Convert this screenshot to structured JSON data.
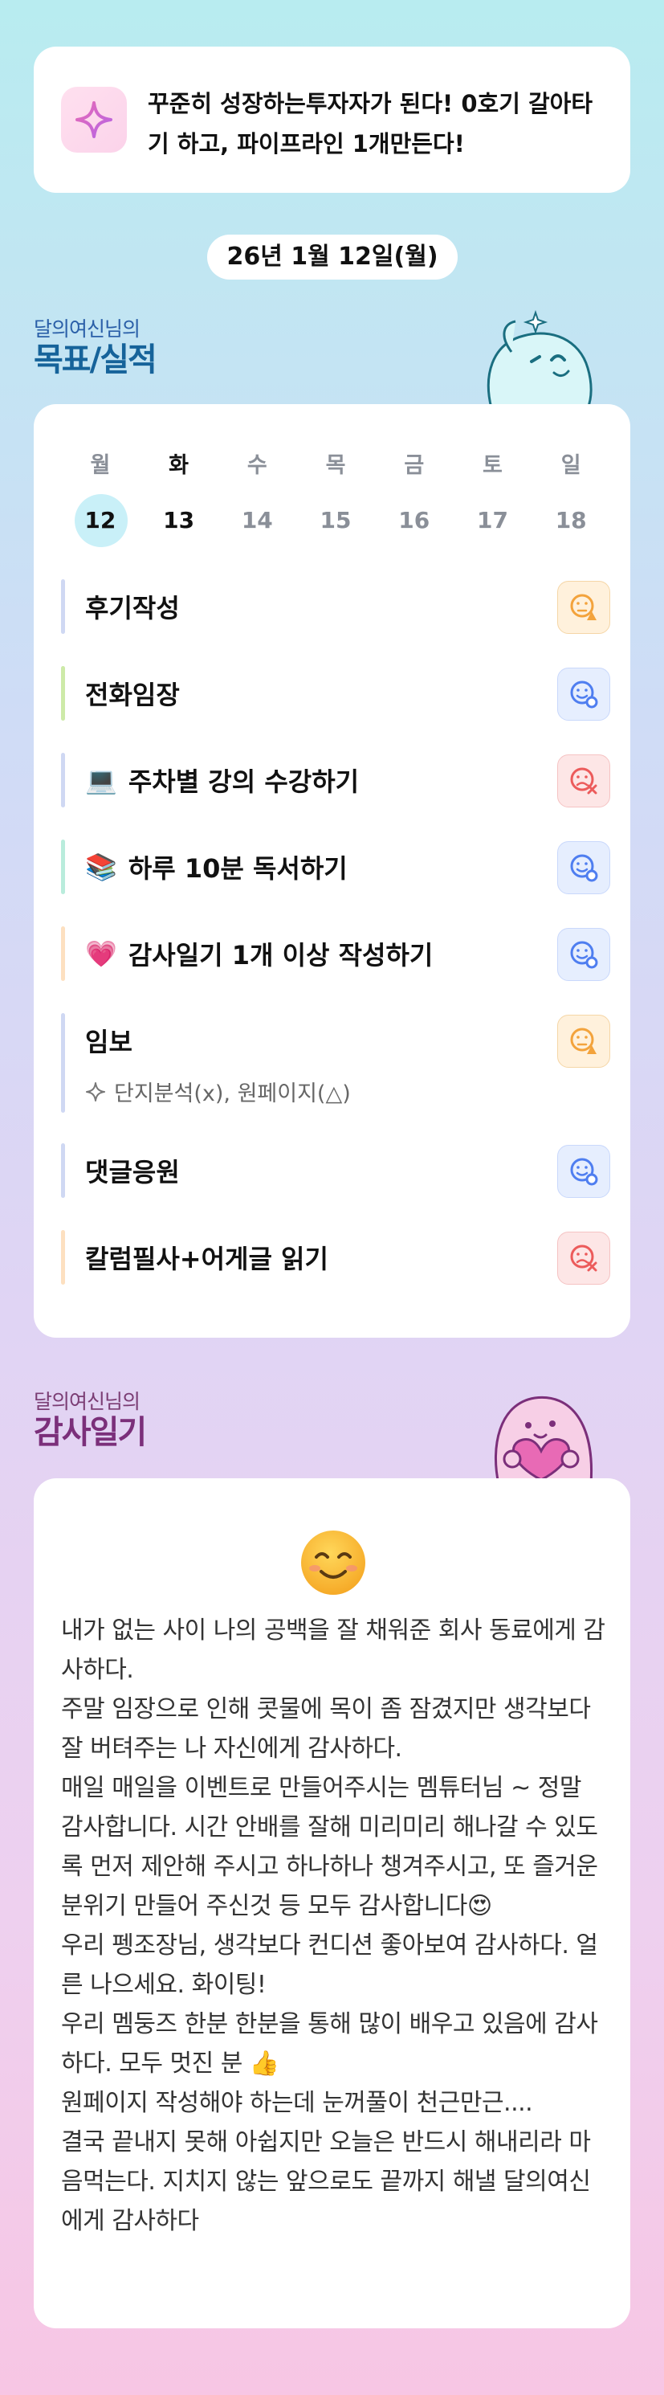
{
  "goal": {
    "icon": "sparkle-icon",
    "text": "꾸준히 성장하는투자자가 된다! 0호기 갈아타기 하고, 파이프라인 1개만든다!"
  },
  "date_label": "26년 1월 12일(월)",
  "goals_section": {
    "subtitle": "달의여신님의",
    "title": "목표/실적"
  },
  "week": {
    "days": [
      "월",
      "화",
      "수",
      "목",
      "금",
      "토",
      "일"
    ],
    "dates": [
      "12",
      "13",
      "14",
      "15",
      "16",
      "17",
      "18"
    ],
    "selected_index": 0,
    "today_index": 1
  },
  "tasks": [
    {
      "name": "후기작성",
      "emoji": "",
      "bar_color": "#cfd8f3",
      "status": "warning",
      "status_icon": "face-warning-icon"
    },
    {
      "name": "전화임장",
      "emoji": "",
      "bar_color": "#cdeaa8",
      "status": "done",
      "status_icon": "face-check-icon"
    },
    {
      "name": "주차별 강의 수강하기",
      "emoji": "💻",
      "bar_color": "#cfd8f3",
      "status": "failed",
      "status_icon": "face-x-icon"
    },
    {
      "name": "하루 10분 독서하기",
      "emoji": "📚",
      "bar_color": "#b9ecdc",
      "status": "done",
      "status_icon": "face-check-icon"
    },
    {
      "name": "감사일기 1개 이상 작성하기",
      "emoji": "💗",
      "bar_color": "#fde0c0",
      "status": "done",
      "status_icon": "face-check-icon"
    },
    {
      "name": "임보",
      "emoji": "",
      "bar_color": "#cfd8f3",
      "status": "warning",
      "status_icon": "face-warning-icon",
      "note": "단지분석(x), 원페이지(△)"
    },
    {
      "name": "댓글응원",
      "emoji": "",
      "bar_color": "#cfd8f3",
      "status": "done",
      "status_icon": "face-check-icon"
    },
    {
      "name": "칼럼필사+어게글 읽기",
      "emoji": "",
      "bar_color": "#fde0c0",
      "status": "failed",
      "status_icon": "face-x-icon"
    }
  ],
  "gratitude_section": {
    "subtitle": "달의여신님의",
    "title": "감사일기"
  },
  "gratitude": {
    "mood_icon": "smiling-face-icon",
    "lines": [
      "내가 없는 사이 나의 공백을 잘 채워준 회사 동료에게 감사하다.",
      "주말 임장으로 인해 콧물에 목이 좀 잠겼지만 생각보다 잘 버텨주는 나 자신에게 감사하다.",
      "매일 매일을 이벤트로 만들어주시는 멤튜터님 ~ 정말 감사합니다. 시간 안배를 잘해 미리미리 해나갈 수 있도록 먼저 제안해 주시고 하나하나 챙겨주시고, 또 즐거운 분위기 만들어 주신것 등 모두 감사합니다😍",
      "우리 펭조장님, 생각보다 컨디션 좋아보여 감사하다. 얼른 나으세요. 화이팅!",
      "우리 멤둥즈 한분 한분을 통해 많이 배우고 있음에 감사하다. 모두 멋진 분 👍",
      "원페이지 작성해야 하는데 눈꺼풀이 천근만근....",
      "결국 끝내지 못해 아쉽지만 오늘은 반드시 해내리라 마음먹는다. 지치지 않는 앞으로도 끝까지 해낼 달의여신에게 감사하다"
    ]
  },
  "colors": {
    "warning": "#f3a33c",
    "done": "#4f7ef0",
    "failed": "#ec5b5b",
    "selected_date_bg": "#c9f0f8"
  }
}
